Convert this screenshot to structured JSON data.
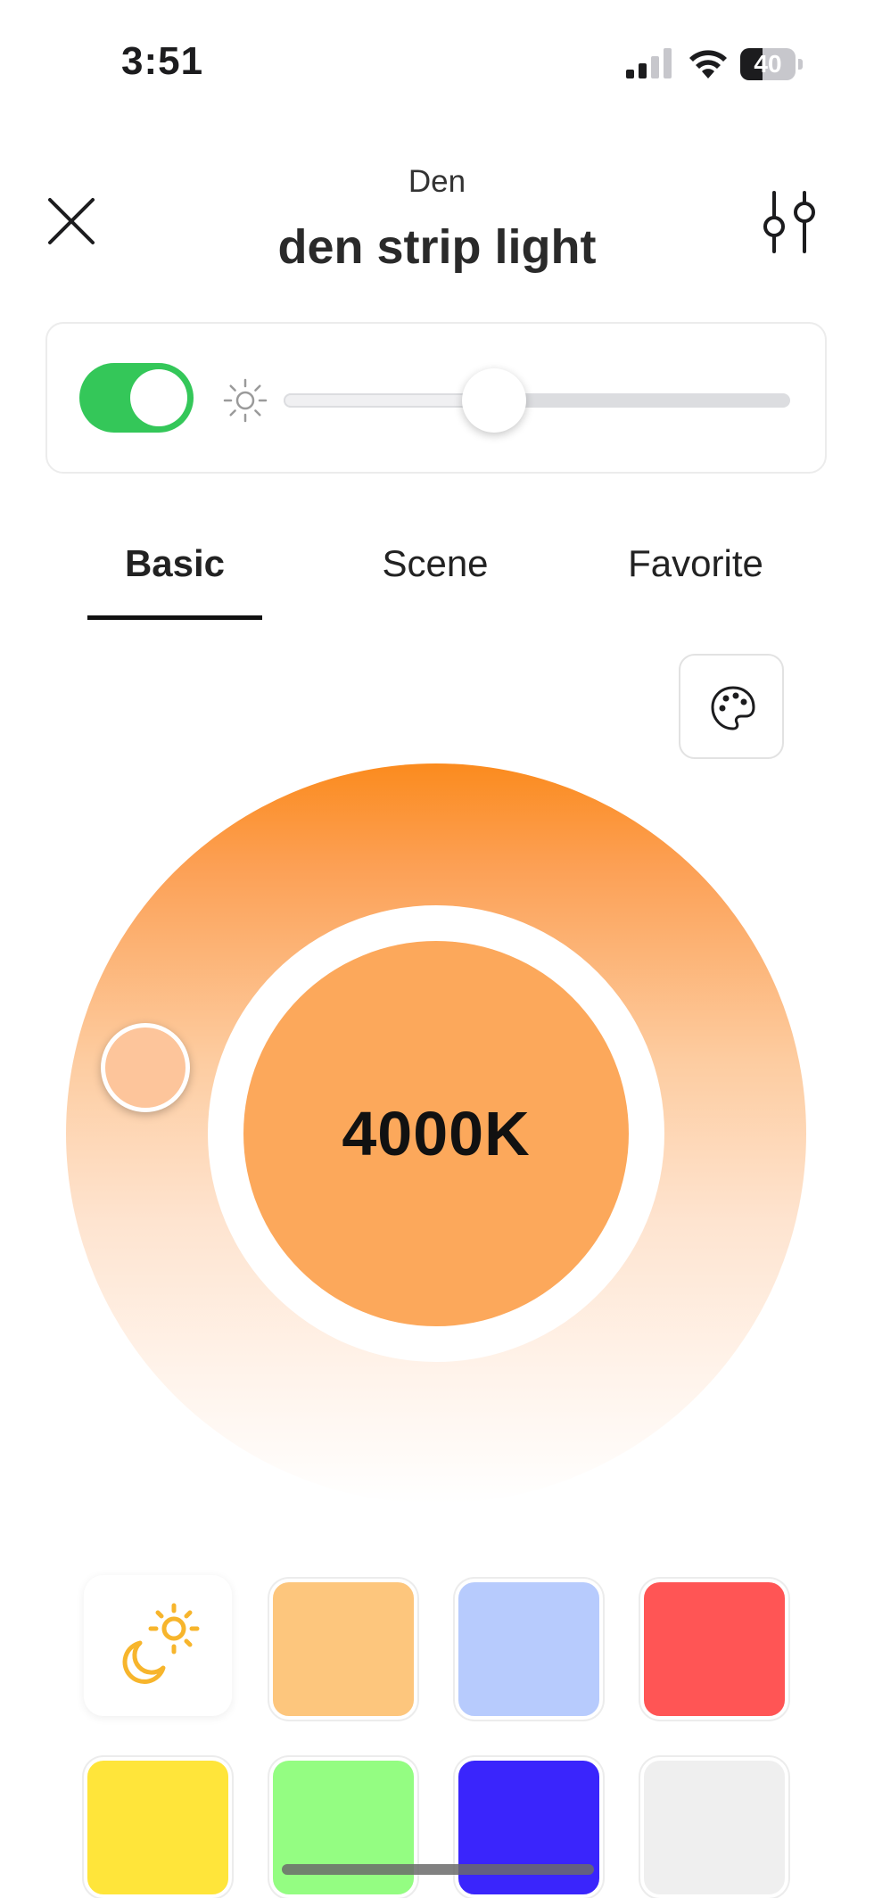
{
  "status_bar": {
    "time": "3:51",
    "battery_level": "40"
  },
  "header": {
    "room": "Den",
    "device_name": "den strip light"
  },
  "controls": {
    "power_on": true,
    "brightness_percent": 42
  },
  "tabs": [
    {
      "label": "Basic",
      "active": true
    },
    {
      "label": "Scene",
      "active": false
    },
    {
      "label": "Favorite",
      "active": false
    }
  ],
  "color_temperature": {
    "value_label": "4000K",
    "center_color": "#fca85b"
  },
  "swatches": [
    {
      "name": "circadian",
      "color": "#ffffff",
      "icon": "sun-moon-icon"
    },
    {
      "name": "warm-orange",
      "color": "#fdc67d"
    },
    {
      "name": "light-blue",
      "color": "#b7cbfd"
    },
    {
      "name": "red",
      "color": "#ff5555"
    },
    {
      "name": "yellow",
      "color": "#ffe53a"
    },
    {
      "name": "green",
      "color": "#94fd82"
    },
    {
      "name": "blue",
      "color": "#3a25fc"
    },
    {
      "name": "light-gray",
      "color": "#efefef"
    }
  ],
  "colors": {
    "toggle_on": "#34c759",
    "wheel_top": "#fb8b1e",
    "icon_accent": "#f7b52c"
  }
}
